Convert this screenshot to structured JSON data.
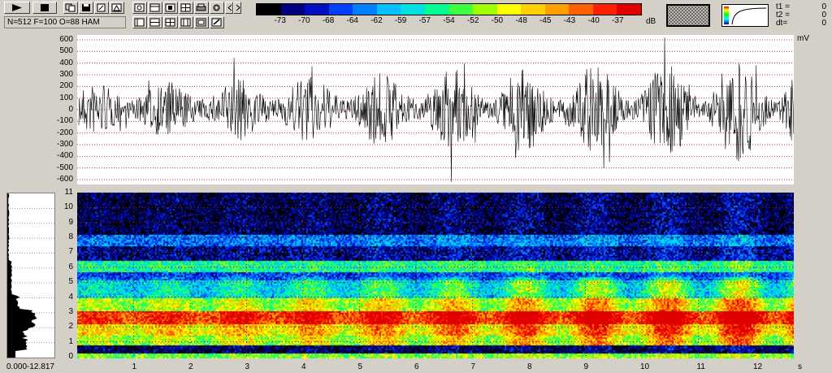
{
  "params": "N=512 F=100 O=88 HAM",
  "colorbar": {
    "labels": [
      "-73",
      "-70",
      "-68",
      "-64",
      "-62",
      "-59",
      "-57",
      "-54",
      "-52",
      "-50",
      "-48",
      "-45",
      "-43",
      "-40",
      "-37"
    ],
    "unit": "dB",
    "colors": [
      "#000000",
      "#000080",
      "#0010c0",
      "#0040ff",
      "#0080ff",
      "#00c0ff",
      "#00e0e0",
      "#00ff90",
      "#40ff40",
      "#a0ff00",
      "#ffff00",
      "#ffd000",
      "#ffa000",
      "#ff6000",
      "#ff2000",
      "#e00000"
    ]
  },
  "readouts": {
    "t1_label": "t1 =",
    "t1_value": "0",
    "t2_label": "t2 =",
    "t2_value": "0",
    "dt_label": "dt=",
    "dt_value": "0"
  },
  "waveform": {
    "unit": "mV",
    "y_ticks": [
      "600",
      "500",
      "400",
      "300",
      "200",
      "100",
      "0",
      "-100",
      "-200",
      "-300",
      "-400",
      "-500",
      "-600"
    ]
  },
  "spectrogram": {
    "y_ticks": [
      "11",
      "10",
      "9",
      "8",
      "7",
      "6",
      "5",
      "4",
      "3",
      "2",
      "1",
      "0"
    ],
    "x_ticks": [
      "1",
      "2",
      "3",
      "4",
      "5",
      "6",
      "7",
      "8",
      "9",
      "10",
      "11",
      "12"
    ],
    "x_unit": "s"
  },
  "histogram_caption": "0.000-12.817"
}
